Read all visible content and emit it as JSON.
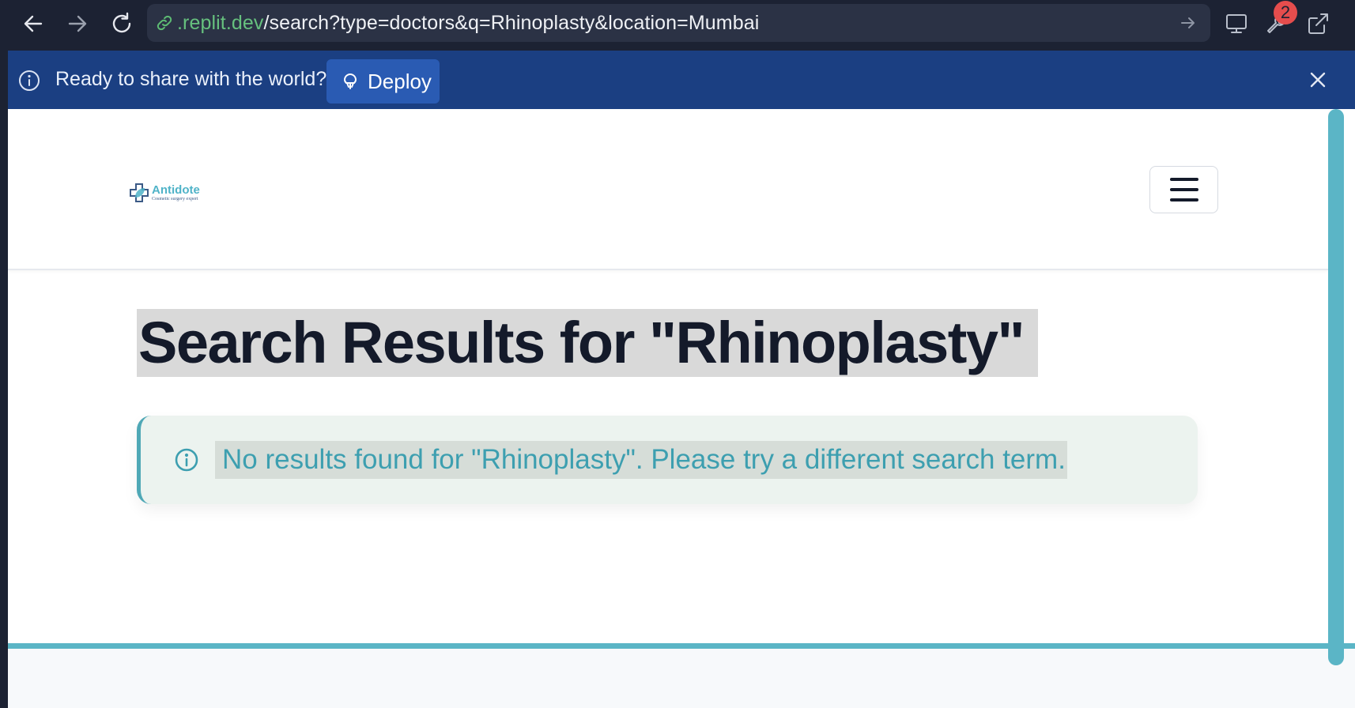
{
  "browser": {
    "back_icon": "arrow-left-icon",
    "forward_icon": "arrow-right-icon",
    "reload_icon": "reload-icon",
    "url": {
      "prefix": ".replit.dev",
      "path": "/search?type=doctors&q=Rhinoplasty&location=Mumbai"
    },
    "tools": {
      "badge_count": "2"
    }
  },
  "banner": {
    "text": "Ready to share with the world?",
    "deploy_label": "Deploy"
  },
  "header": {
    "logo_name": "Antidote",
    "logo_tagline": "Cosmetic surgery expert"
  },
  "main": {
    "title": "Search Results for \"Rhinoplasty\"",
    "alert_text": "No results found for \"Rhinoplasty\". Please try a different search term."
  },
  "colors": {
    "brand_teal": "#5bb5c6",
    "banner_blue": "#1b3f82",
    "deploy_blue": "#2a5bb3",
    "alert_bg": "#ecf3ef",
    "alert_text": "#3d9fb0",
    "title_text": "#141a2a"
  }
}
